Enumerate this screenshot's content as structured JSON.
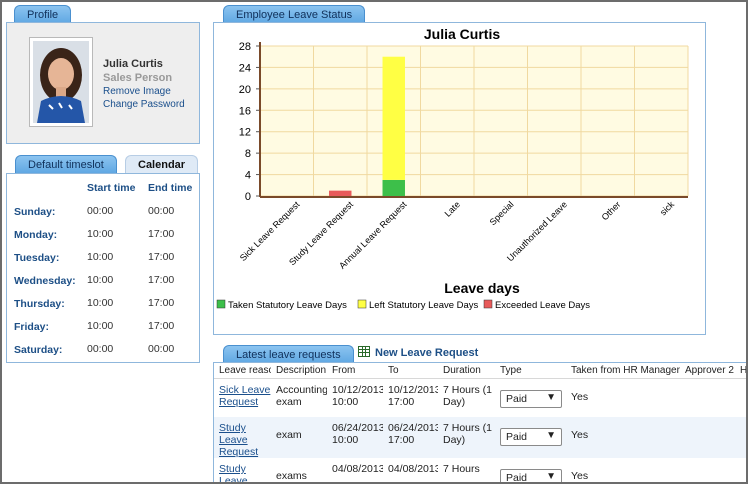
{
  "profile": {
    "tab_label": "Profile",
    "name": "Julia Curtis",
    "role": "Sales Person",
    "remove_image": "Remove Image",
    "change_password": "Change Password"
  },
  "timeslot": {
    "tab_default": "Default timeslot",
    "tab_calendar": "Calendar",
    "start_header": "Start time",
    "end_header": "End time",
    "days": [
      {
        "day": "Sunday:",
        "start": "00:00",
        "end": "00:00"
      },
      {
        "day": "Monday:",
        "start": "10:00",
        "end": "17:00"
      },
      {
        "day": "Tuesday:",
        "start": "10:00",
        "end": "17:00"
      },
      {
        "day": "Wednesday:",
        "start": "10:00",
        "end": "17:00"
      },
      {
        "day": "Thursday:",
        "start": "10:00",
        "end": "17:00"
      },
      {
        "day": "Friday:",
        "start": "10:00",
        "end": "17:00"
      },
      {
        "day": "Saturday:",
        "start": "00:00",
        "end": "00:00"
      }
    ]
  },
  "status": {
    "tab_label": "Employee Leave Status"
  },
  "chart_data": {
    "type": "bar",
    "stacked": true,
    "title": "Julia Curtis",
    "xlabel": "Leave days",
    "ylabel": "",
    "ylim": [
      0,
      28
    ],
    "yticks": [
      0,
      4,
      8,
      12,
      16,
      20,
      24,
      28
    ],
    "grid": true,
    "legend_position": "bottom",
    "categories": [
      "Sick Leave Request",
      "Study Leave Request",
      "Annual Leave Request",
      "Late",
      "Special",
      "Unauthorized Leave",
      "Other",
      "sick"
    ],
    "series": [
      {
        "name": "Taken Statutory Leave Days",
        "color": "#3dbf4a",
        "values": [
          0,
          0,
          3,
          0,
          0,
          0,
          0,
          0
        ]
      },
      {
        "name": "Left Statutory Leave Days",
        "color": "#ffff44",
        "values": [
          0,
          0,
          23,
          0,
          0,
          0,
          0,
          0
        ]
      },
      {
        "name": "Exceeded Leave Days",
        "color": "#e85a5a",
        "values": [
          0,
          1,
          0,
          0,
          0,
          0,
          0,
          0
        ]
      }
    ]
  },
  "latest": {
    "tab_label": "Latest leave requests",
    "new_request": "New Leave Request",
    "columns": [
      "Leave reason",
      "Description",
      "From",
      "To",
      "Duration",
      "Type",
      "Taken from HR Manager",
      "Approver 2",
      "H"
    ],
    "rows": [
      {
        "reason": "Sick Leave Request",
        "description": "Accounting exam",
        "from": "10/12/2013 10:00",
        "to": "10/12/2013 17:00",
        "duration": "7 Hours (1 Day)",
        "type": "Paid",
        "taken": "Yes"
      },
      {
        "reason": "Study Leave Request",
        "description": "exam",
        "from": "06/24/2013 10:00",
        "to": "06/24/2013 17:00",
        "duration": "7 Hours (1 Day)",
        "type": "Paid",
        "taken": "Yes"
      },
      {
        "reason": "Study Leave Request",
        "description": "exams",
        "from": "04/08/2013",
        "to": "04/08/2013",
        "duration": "7 Hours",
        "type": "Paid",
        "taken": "Yes"
      }
    ]
  }
}
